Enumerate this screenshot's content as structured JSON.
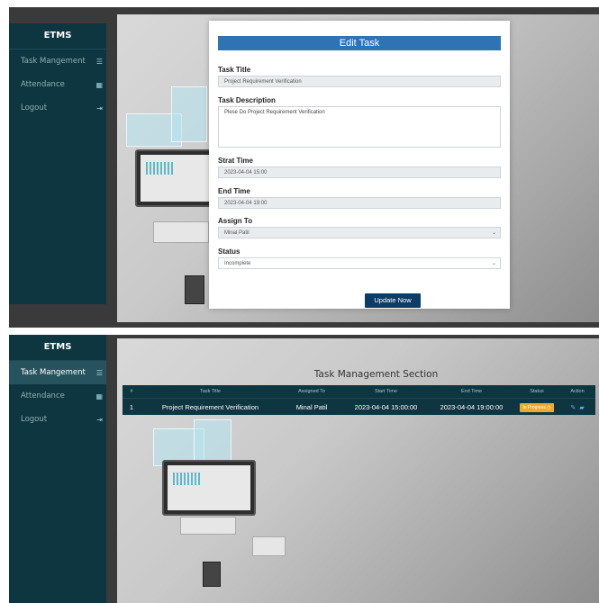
{
  "sidebar": {
    "brand": "ETMS",
    "items": [
      {
        "label": "Task Mangement",
        "icon": "list-icon"
      },
      {
        "label": "Attendance",
        "icon": "calendar-icon"
      },
      {
        "label": "Logout",
        "icon": "logout-icon"
      }
    ]
  },
  "edit_form": {
    "title": "Edit Task",
    "task_title_label": "Task Title",
    "task_title_value": "Project Requirement Verification",
    "task_description_label": "Task Description",
    "task_description_value": "Plese Do Project Requirement Verification",
    "start_time_label": "Strat Time",
    "start_time_value": "2023-04-04 15:00",
    "end_time_label": "End Time",
    "end_time_value": "2023-04-04 19:00",
    "assign_to_label": "Assign To",
    "assign_to_value": "Minal Patil",
    "status_label": "Status",
    "status_value": "Incomplete",
    "submit_label": "Update Now"
  },
  "task_section": {
    "title": "Task Management Section",
    "columns": [
      "#",
      "Task Title",
      "Assigned To",
      "Start Time",
      "End Time",
      "Status",
      "Action"
    ],
    "rows": [
      {
        "num": "1",
        "title": "Project Requirement Verification",
        "assigned_to": "Minal Patil",
        "start": "2023-04-04 15:00:00",
        "end": "2023-04-04 19:00:00",
        "status": "In Progress",
        "status_color": "#f0a92c"
      }
    ]
  },
  "colors": {
    "sidebar": "#0e3641",
    "form_header": "#2f73b5",
    "button": "#0b3d67"
  }
}
